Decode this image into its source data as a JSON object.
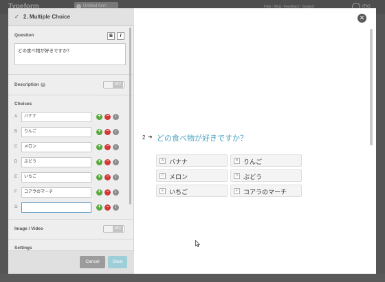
{
  "app": {
    "brand": "Typeform",
    "breadcrumb": "Untitled form",
    "top_links": "Help · Blog · Feedback · Support",
    "user": "ITIG"
  },
  "editor": {
    "header": {
      "number": "2.",
      "title": "Multiple Choice"
    },
    "question": {
      "label": "Question",
      "bold": "B",
      "italic": "I",
      "value": "どの食べ物が好きですか？"
    },
    "description": {
      "label": "Description",
      "toggle": "OFF"
    },
    "choices": {
      "label": "Choices",
      "items": [
        {
          "letter": "A",
          "value": "バナナ"
        },
        {
          "letter": "B",
          "value": "りんご"
        },
        {
          "letter": "C",
          "value": "メロン"
        },
        {
          "letter": "D",
          "value": "ぶどう"
        },
        {
          "letter": "E",
          "value": "いちご"
        },
        {
          "letter": "F",
          "value": "コアラのマーチ"
        },
        {
          "letter": "G",
          "value": ""
        }
      ]
    },
    "image_video": {
      "label": "Image / Video",
      "toggle": "OFF"
    },
    "settings": {
      "label": "Settings"
    },
    "footer": {
      "cancel": "Cancel",
      "save": "Save"
    }
  },
  "preview": {
    "number": "2",
    "arrow": "➜",
    "question": "どの食べ物が好きですか？",
    "options": [
      {
        "key": "A",
        "label": "バナナ"
      },
      {
        "key": "B",
        "label": "りんご"
      },
      {
        "key": "C",
        "label": "メロン"
      },
      {
        "key": "D",
        "label": "ぶどう"
      },
      {
        "key": "E",
        "label": "いちご"
      },
      {
        "key": "F",
        "label": "コアラのマーチ"
      }
    ]
  }
}
